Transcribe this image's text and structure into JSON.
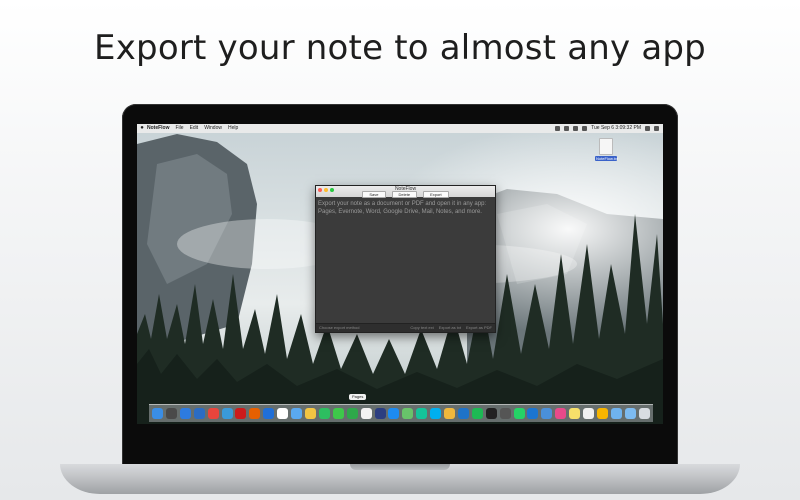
{
  "headline": "Export your note to almost any app",
  "menubar": {
    "app_name": "NoteFlow",
    "items": [
      "File",
      "Edit",
      "Window",
      "Help"
    ],
    "clock": "Tue Sep 6 3:09:32 PM"
  },
  "desktop_file": {
    "label": "NoteFlow.txt"
  },
  "window": {
    "title": "NoteFlow",
    "buttons": [
      "Save",
      "Delete",
      "Export"
    ],
    "body_text": "Export your note as a document or PDF and open it in any app: Pages, Evernote, Word, Google Drive, Mail, Notes, and more.",
    "footer_left": "Choose export method",
    "footer_buttons": [
      "Copy text ext",
      "Export as txt",
      "Export as PDF"
    ],
    "traffic_light_colors": [
      "#ff5f57",
      "#ffbd2e",
      "#28c940"
    ]
  },
  "dock": {
    "tooltip": "Pages",
    "icons": [
      {
        "name": "finder-icon",
        "color": "#3a8ee6"
      },
      {
        "name": "launchpad-icon",
        "color": "#4a4a4a"
      },
      {
        "name": "safari-icon",
        "color": "#2d7be0"
      },
      {
        "name": "compass-icon",
        "color": "#2b6cc4"
      },
      {
        "name": "chrome-icon",
        "color": "#e8453c"
      },
      {
        "name": "globe-icon",
        "color": "#3a9ad9"
      },
      {
        "name": "opera-icon",
        "color": "#cc1b1b"
      },
      {
        "name": "firefox-icon",
        "color": "#e66000"
      },
      {
        "name": "bluetooth-icon",
        "color": "#1f6fd8"
      },
      {
        "name": "calendar-icon",
        "color": "#ffffff"
      },
      {
        "name": "mail-icon",
        "color": "#5aa9f0"
      },
      {
        "name": "notes-icon",
        "color": "#f2c542"
      },
      {
        "name": "evernote-icon",
        "color": "#2dbe60"
      },
      {
        "name": "messages-icon",
        "color": "#3ec84a"
      },
      {
        "name": "facetime-icon",
        "color": "#2ea84a"
      },
      {
        "name": "pages-icon",
        "color": "#f3f3f3"
      },
      {
        "name": "noteflow-icon",
        "color": "#2c3e80"
      },
      {
        "name": "appstore-icon",
        "color": "#1d8bf1"
      },
      {
        "name": "maps-icon",
        "color": "#68c36a"
      },
      {
        "name": "grammarly-icon",
        "color": "#15c39a"
      },
      {
        "name": "skype-icon",
        "color": "#00aff0"
      },
      {
        "name": "photos-icon",
        "color": "#f0b83c"
      },
      {
        "name": "onedrive-icon",
        "color": "#1e73c9"
      },
      {
        "name": "spotify-icon",
        "color": "#1db954"
      },
      {
        "name": "terminal-icon",
        "color": "#222222"
      },
      {
        "name": "camera-icon",
        "color": "#555555"
      },
      {
        "name": "whatsapp-icon",
        "color": "#25d366"
      },
      {
        "name": "xcode-icon",
        "color": "#1b75d0"
      },
      {
        "name": "pencil-icon",
        "color": "#4a90d9"
      },
      {
        "name": "itunes-icon",
        "color": "#e84a8a"
      },
      {
        "name": "stickies-icon",
        "color": "#f6e06a"
      },
      {
        "name": "notepad-icon",
        "color": "#f0f0f0"
      },
      {
        "name": "sketch-icon",
        "color": "#f7b500"
      },
      {
        "name": "folder-icon",
        "color": "#6fb3ee"
      },
      {
        "name": "downloads-icon",
        "color": "#7dbbf0"
      },
      {
        "name": "trash-icon",
        "color": "#d8dde2"
      }
    ]
  }
}
